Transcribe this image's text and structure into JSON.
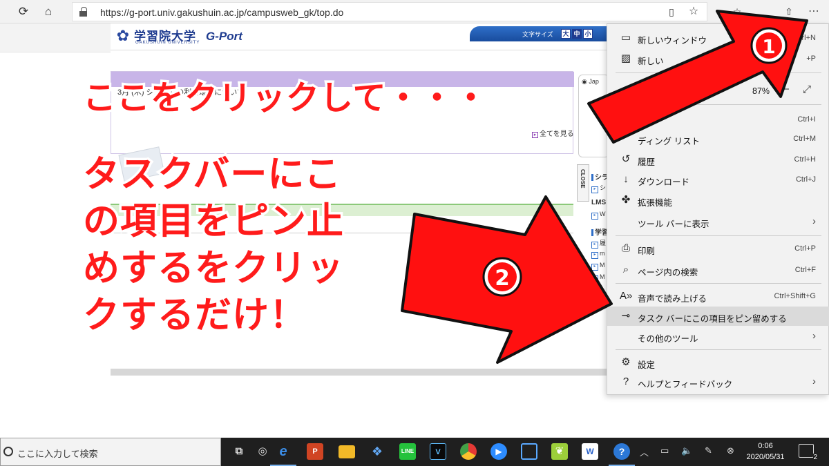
{
  "browser": {
    "url": "https://g-port.univ.gakushuin.ac.jp/campusweb_gk/top.do"
  },
  "site": {
    "logo_title": "学習院大学",
    "logo_sub": "GAKUSHUIN UNIVERSITY",
    "portal_name": "G-Port",
    "font_size_label": "文字サイズ",
    "font_sizes": [
      "大",
      "中",
      "小"
    ],
    "news_row": "3月 (木)     システムの利用環境について",
    "see_all": "全てを見る",
    "side_radio": "Jap",
    "close_label": "CLOSE",
    "side_list": [
      "シラ",
      "シ",
      "LMS",
      "W",
      "学習",
      "履",
      "m",
      "M",
      "M"
    ]
  },
  "menu": {
    "items": [
      {
        "label": "新しいウィンドウ",
        "shortcut": "Ctrl+N",
        "icon": "new-window-icon"
      },
      {
        "label": "新しい",
        "shortcut": "+P",
        "icon": "inprivate-window-icon"
      },
      {
        "label": "",
        "shortcut": "Ctrl+I",
        "icon": ""
      },
      {
        "label": "ディング リスト",
        "shortcut": "Ctrl+M",
        "icon": ""
      },
      {
        "label": "履歴",
        "shortcut": "Ctrl+H",
        "icon": "history-icon"
      },
      {
        "label": "ダウンロード",
        "shortcut": "Ctrl+J",
        "icon": "download-icon"
      },
      {
        "label": "拡張機能",
        "shortcut": "",
        "icon": "extensions-icon"
      },
      {
        "label": "ツール バーに表示",
        "shortcut": "",
        "icon": ""
      },
      {
        "label": "印刷",
        "shortcut": "Ctrl+P",
        "icon": "print-icon"
      },
      {
        "label": "ページ内の検索",
        "shortcut": "Ctrl+F",
        "icon": "find-icon"
      },
      {
        "label": "音声で読み上げる",
        "shortcut": "Ctrl+Shift+G",
        "icon": "read-aloud-icon"
      },
      {
        "label": "タスク バーにこの項目をピン留めする",
        "shortcut": "",
        "icon": "pin-icon"
      },
      {
        "label": "その他のツール",
        "shortcut": "",
        "icon": ""
      },
      {
        "label": "設定",
        "shortcut": "",
        "icon": "settings-icon"
      },
      {
        "label": "ヘルプとフィードバック",
        "shortcut": "",
        "icon": "help-icon"
      }
    ],
    "zoom": "87%"
  },
  "overlay": {
    "headline": "ここをクリックして・・・",
    "body_lines": [
      "タスクバーにこ",
      "の項目をピン止",
      "めするをクリッ",
      "クするだけ！"
    ],
    "marker1": "①",
    "marker2": "②",
    "arrow_color": "#ff1010"
  },
  "taskbar": {
    "search_placeholder": "ここに入力して検索",
    "time": "0:06",
    "date": "2020/05/31",
    "notification_count": "2"
  }
}
